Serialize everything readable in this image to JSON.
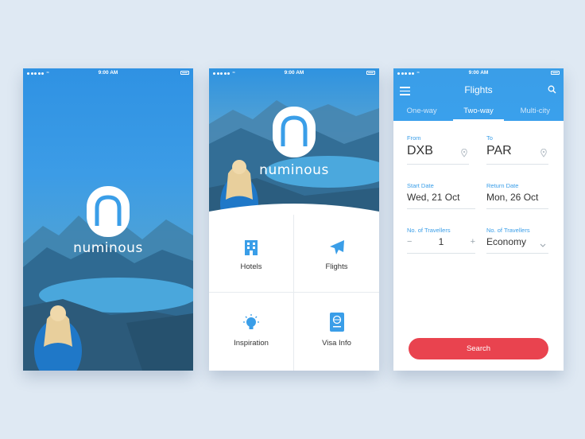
{
  "status_bar": {
    "time": "9:00 AM"
  },
  "brand": {
    "name": "numinous"
  },
  "home": {
    "tiles": [
      {
        "label": "Hotels",
        "icon": "hotel-icon"
      },
      {
        "label": "Flights",
        "icon": "plane-icon"
      },
      {
        "label": "Inspiration",
        "icon": "lightbulb-icon"
      },
      {
        "label": "Visa Info",
        "icon": "passport-icon"
      }
    ]
  },
  "flights": {
    "title": "Flights",
    "tabs": [
      "One-way",
      "Two-way",
      "Multi-city"
    ],
    "active_tab": "Two-way",
    "from": {
      "label": "From",
      "value": "DXB"
    },
    "to": {
      "label": "To",
      "value": "PAR"
    },
    "start_date": {
      "label": "Start Date",
      "value": "Wed, 21 Oct"
    },
    "return_date": {
      "label": "Return Date",
      "value": "Mon, 26 Oct"
    },
    "travellers": {
      "label": "No. of Travellers",
      "value": "1",
      "minus": "−",
      "plus": "+"
    },
    "class": {
      "label": "No. of Travellers",
      "value": "Economy"
    },
    "search_label": "Search"
  },
  "colors": {
    "accent": "#3a9ee8",
    "search": "#e9434f",
    "background": "#dfe9f3"
  }
}
